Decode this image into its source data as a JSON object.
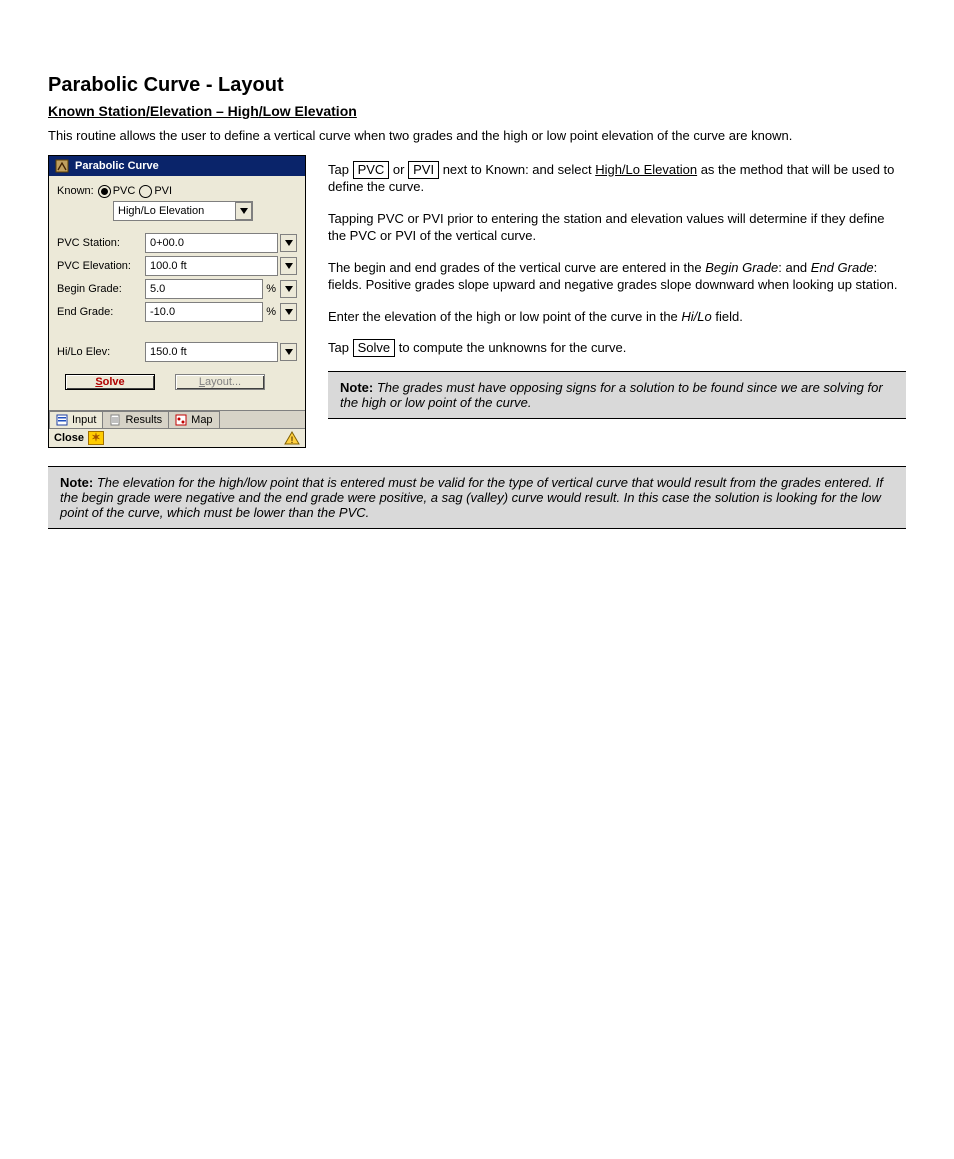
{
  "heading": "Parabolic Curve - Layout",
  "subhead": "Known Station/Elevation – High/Low Elevation",
  "intro": "This routine allows the user to define a vertical curve when two grades and the high or low point elevation of the curve are known.",
  "para1_pre": "Tap ",
  "para1_b1": "PVC",
  "para1_mid": " or ",
  "para1_b2": "PVI",
  "para1_mid2": " next to Known: and select ",
  "para1_link": "High/Lo Elevation",
  "para1_post": " as the method that will be used to define the curve.",
  "para2": "Tapping PVC or PVI prior to entering the station and elevation values will determine if they define the PVC or PVI of the vertical curve.",
  "para3_pre": "The begin and end grades of the vertical curve are entered in the ",
  "para3_em": "Begin Grade",
  "para3_mid": ": and ",
  "para3_em2": "End Grade",
  "para3_post": ": fields.  Positive grades slope upward and negative grades slope downward when looking up station.",
  "para4_pre": "Enter the elevation of the high or low point of the curve in the ",
  "para4_em": "Hi/Lo",
  "para4_post": " field.",
  "para5_pre": "Tap ",
  "para5_btn": "Solve",
  "para5_post": " to compute the unknowns for the curve.",
  "note1_label": "Note:",
  "note1_body": " The grades must have opposing signs for a solution to be found since we are solving for the high or low point of the curve.",
  "note2_label": "Note:",
  "note2_body": " The elevation for the high/low point that is entered must be valid for the type of vertical curve that would result from the grades entered.  If the begin grade were negative and the end grade were positive, a sag (valley) curve would result.  In this case the solution is looking for the low point of the curve, which must be lower than the PVC.",
  "screenshot": {
    "title": "Parabolic Curve",
    "knownLabel": "Known:",
    "radioPVC": "PVC",
    "radioPVI": "PVI",
    "method": "High/Lo Elevation",
    "rows": {
      "r1": {
        "label": "PVC Station:",
        "value": "0+00.0",
        "unit": ""
      },
      "r2": {
        "label": "PVC Elevation:",
        "value": "100.0 ft",
        "unit": ""
      },
      "r3": {
        "label": "Begin Grade:",
        "value": "5.0",
        "unit": "%"
      },
      "r4": {
        "label": "End Grade:",
        "value": "-10.0",
        "unit": "%"
      },
      "r5": {
        "label": "Hi/Lo Elev:",
        "value": "150.0 ft",
        "unit": ""
      }
    },
    "solve": "Solve",
    "layout": "Layout...",
    "tabs": {
      "input": "Input",
      "results": "Results",
      "map": "Map"
    },
    "close": "Close"
  }
}
